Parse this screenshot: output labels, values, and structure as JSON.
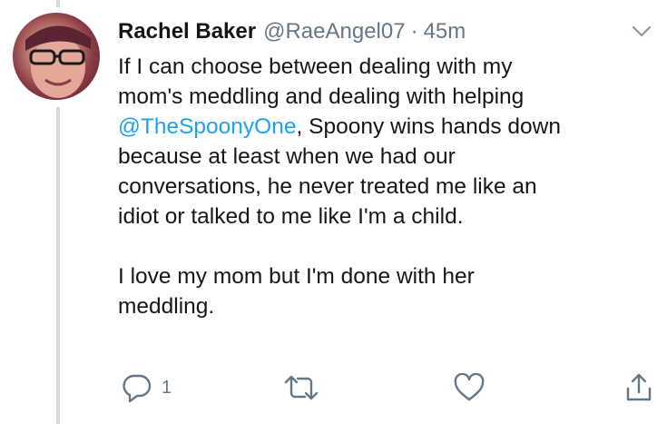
{
  "tweet": {
    "author_name": "Rachel Baker",
    "author_handle": "@RaeAngel07",
    "separator": "·",
    "timestamp": "45m",
    "text_before_mention": "If I can choose between dealing with my\nmom's meddling and dealing with helping\n",
    "mention": "@TheSpoonyOne",
    "text_after_mention": ", Spoony wins hands down\nbecause at least when we had our\nconversations, he never treated me like an\nidiot or talked to me like I'm a child.\n\nI love my mom but I'm done with her\nmeddling."
  },
  "actions": {
    "reply_count": "1",
    "icons": [
      "reply-icon",
      "retweet-icon",
      "like-icon",
      "share-icon"
    ]
  },
  "colors": {
    "text": "#14171a",
    "secondary": "#657786",
    "link": "#1da1f2",
    "thread_line": "#cfd9de"
  }
}
